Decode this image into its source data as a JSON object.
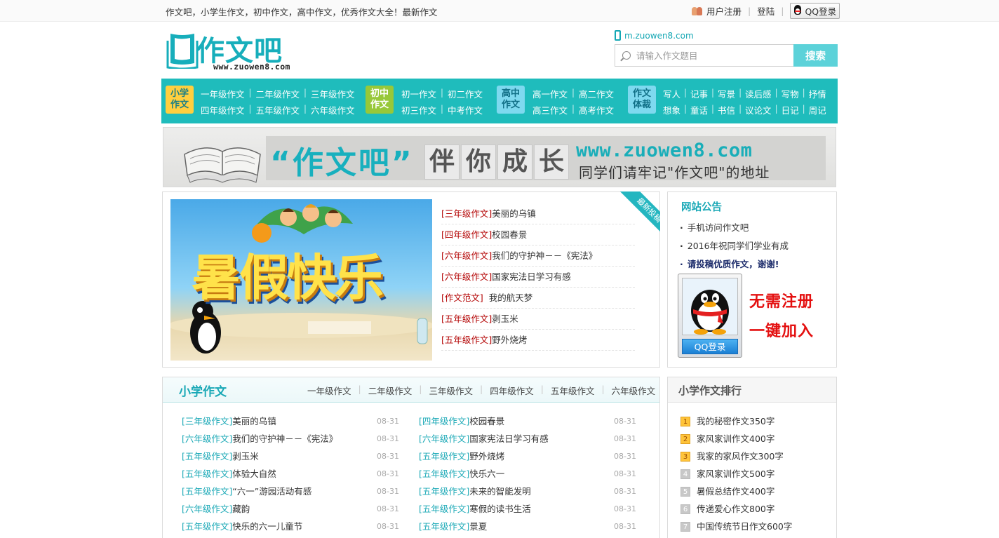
{
  "top_bar": {
    "slogan": "作文吧，小学生作文，初中作文，高中作文，优秀作文大全！最新作文",
    "register": "用户注册",
    "login": "登陆",
    "qq_login": "QQ登录",
    "separator": "|"
  },
  "logo": {
    "text": "作文吧",
    "url": "www.zuowen8.com"
  },
  "header": {
    "mobile_link": "m.zuowen8.com",
    "search_placeholder": "请输入作文题目",
    "search_button": "搜索"
  },
  "nav": {
    "groups": [
      {
        "badge_line1": "小学",
        "badge_line2": "作文",
        "rows": [
          [
            "一年级作文",
            "二年级作文",
            "三年级作文"
          ],
          [
            "四年级作文",
            "五年级作文",
            "六年级作文"
          ]
        ]
      },
      {
        "badge_line1": "初中",
        "badge_line2": "作文",
        "rows": [
          [
            "初一作文",
            "初二作文"
          ],
          [
            "初三作文",
            "中考作文"
          ]
        ]
      },
      {
        "badge_line1": "高中",
        "badge_line2": "作文",
        "rows": [
          [
            "高一作文",
            "高二作文"
          ],
          [
            "高三作文",
            "高考作文"
          ]
        ]
      },
      {
        "badge_line1": "作文",
        "badge_line2": "体裁",
        "rows": [
          [
            "写人",
            "记事",
            "写景",
            "读后感",
            "写物",
            "抒情"
          ],
          [
            "想象",
            "童话",
            "书信",
            "议论文",
            "日记",
            "周记"
          ]
        ]
      }
    ]
  },
  "banner": {
    "quote": "“作文吧”",
    "grow": [
      "伴",
      "你",
      "成",
      "长"
    ],
    "domain": "www.zuowen8.com",
    "remember": "同学们请牢记\"作文吧\"的地址"
  },
  "featured": {
    "image_title": "暑假快乐",
    "ribbon": "最新投稿",
    "items": [
      {
        "cat": "[三年级作文]",
        "title": "美丽的乌镇"
      },
      {
        "cat": "[四年级作文]",
        "title": "校园春景"
      },
      {
        "cat": "[六年级作文]",
        "title": "我们的守护神－－《宪法》"
      },
      {
        "cat": "[六年级作文]",
        "title": "国家宪法日学习有感"
      },
      {
        "cat": "[作文范文]",
        "title": "我的航天梦"
      },
      {
        "cat": "[五年级作文]",
        "title": "剥玉米"
      },
      {
        "cat": "[五年级作文]",
        "title": "野外烧烤"
      }
    ]
  },
  "notice": {
    "title": "网站公告",
    "items": [
      "手机访问作文吧",
      "2016年祝同学们学业有成",
      "请投稿优质作文，谢谢!"
    ],
    "qq_button": "QQ登录",
    "slogan_line1": "无需注册",
    "slogan_line2": "一键加入"
  },
  "primary": {
    "title": "小学作文",
    "tabs": [
      "一年级作文",
      "二年级作文",
      "三年级作文",
      "四年级作文",
      "五年级作文",
      "六年级作文"
    ],
    "left": [
      {
        "cat": "[三年级作文]",
        "title": "美丽的乌镇",
        "date": "08-31"
      },
      {
        "cat": "[六年级作文]",
        "title": "我们的守护神－－《宪法》",
        "date": "08-31"
      },
      {
        "cat": "[五年级作文]",
        "title": "剥玉米",
        "date": "08-31"
      },
      {
        "cat": "[五年级作文]",
        "title": "体验大自然",
        "date": "08-31"
      },
      {
        "cat": "[五年级作文]",
        "title": "“六一”游园活动有感",
        "date": "08-31"
      },
      {
        "cat": "[六年级作文]",
        "title": "藏韵",
        "date": "08-31"
      },
      {
        "cat": "[五年级作文]",
        "title": "快乐的六一儿童节",
        "date": "08-31"
      }
    ],
    "right": [
      {
        "cat": "[四年级作文]",
        "title": "校园春景",
        "date": "08-31"
      },
      {
        "cat": "[六年级作文]",
        "title": "国家宪法日学习有感",
        "date": "08-31"
      },
      {
        "cat": "[五年级作文]",
        "title": "野外烧烤",
        "date": "08-31"
      },
      {
        "cat": "[五年级作文]",
        "title": "快乐六一",
        "date": "08-31"
      },
      {
        "cat": "[五年级作文]",
        "title": "未来的智能发明",
        "date": "08-31"
      },
      {
        "cat": "[五年级作文]",
        "title": "寒假的读书生活",
        "date": "08-31"
      },
      {
        "cat": "[五年级作文]",
        "title": "景夏",
        "date": "08-31"
      }
    ]
  },
  "ranking": {
    "title": "小学作文排行",
    "items": [
      {
        "num": "1",
        "title": "我的秘密作文350字"
      },
      {
        "num": "2",
        "title": "家风家训作文400字"
      },
      {
        "num": "3",
        "title": "我家的家风作文300字"
      },
      {
        "num": "4",
        "title": "家风家训作文500字"
      },
      {
        "num": "5",
        "title": "暑假总结作文400字"
      },
      {
        "num": "6",
        "title": "传递爱心作文800字"
      },
      {
        "num": "7",
        "title": "中国传统节日作文600字"
      }
    ]
  },
  "colors": {
    "brand_teal": "#1fbcbc",
    "category_red": "#b30000",
    "accent_red": "#e41010"
  }
}
